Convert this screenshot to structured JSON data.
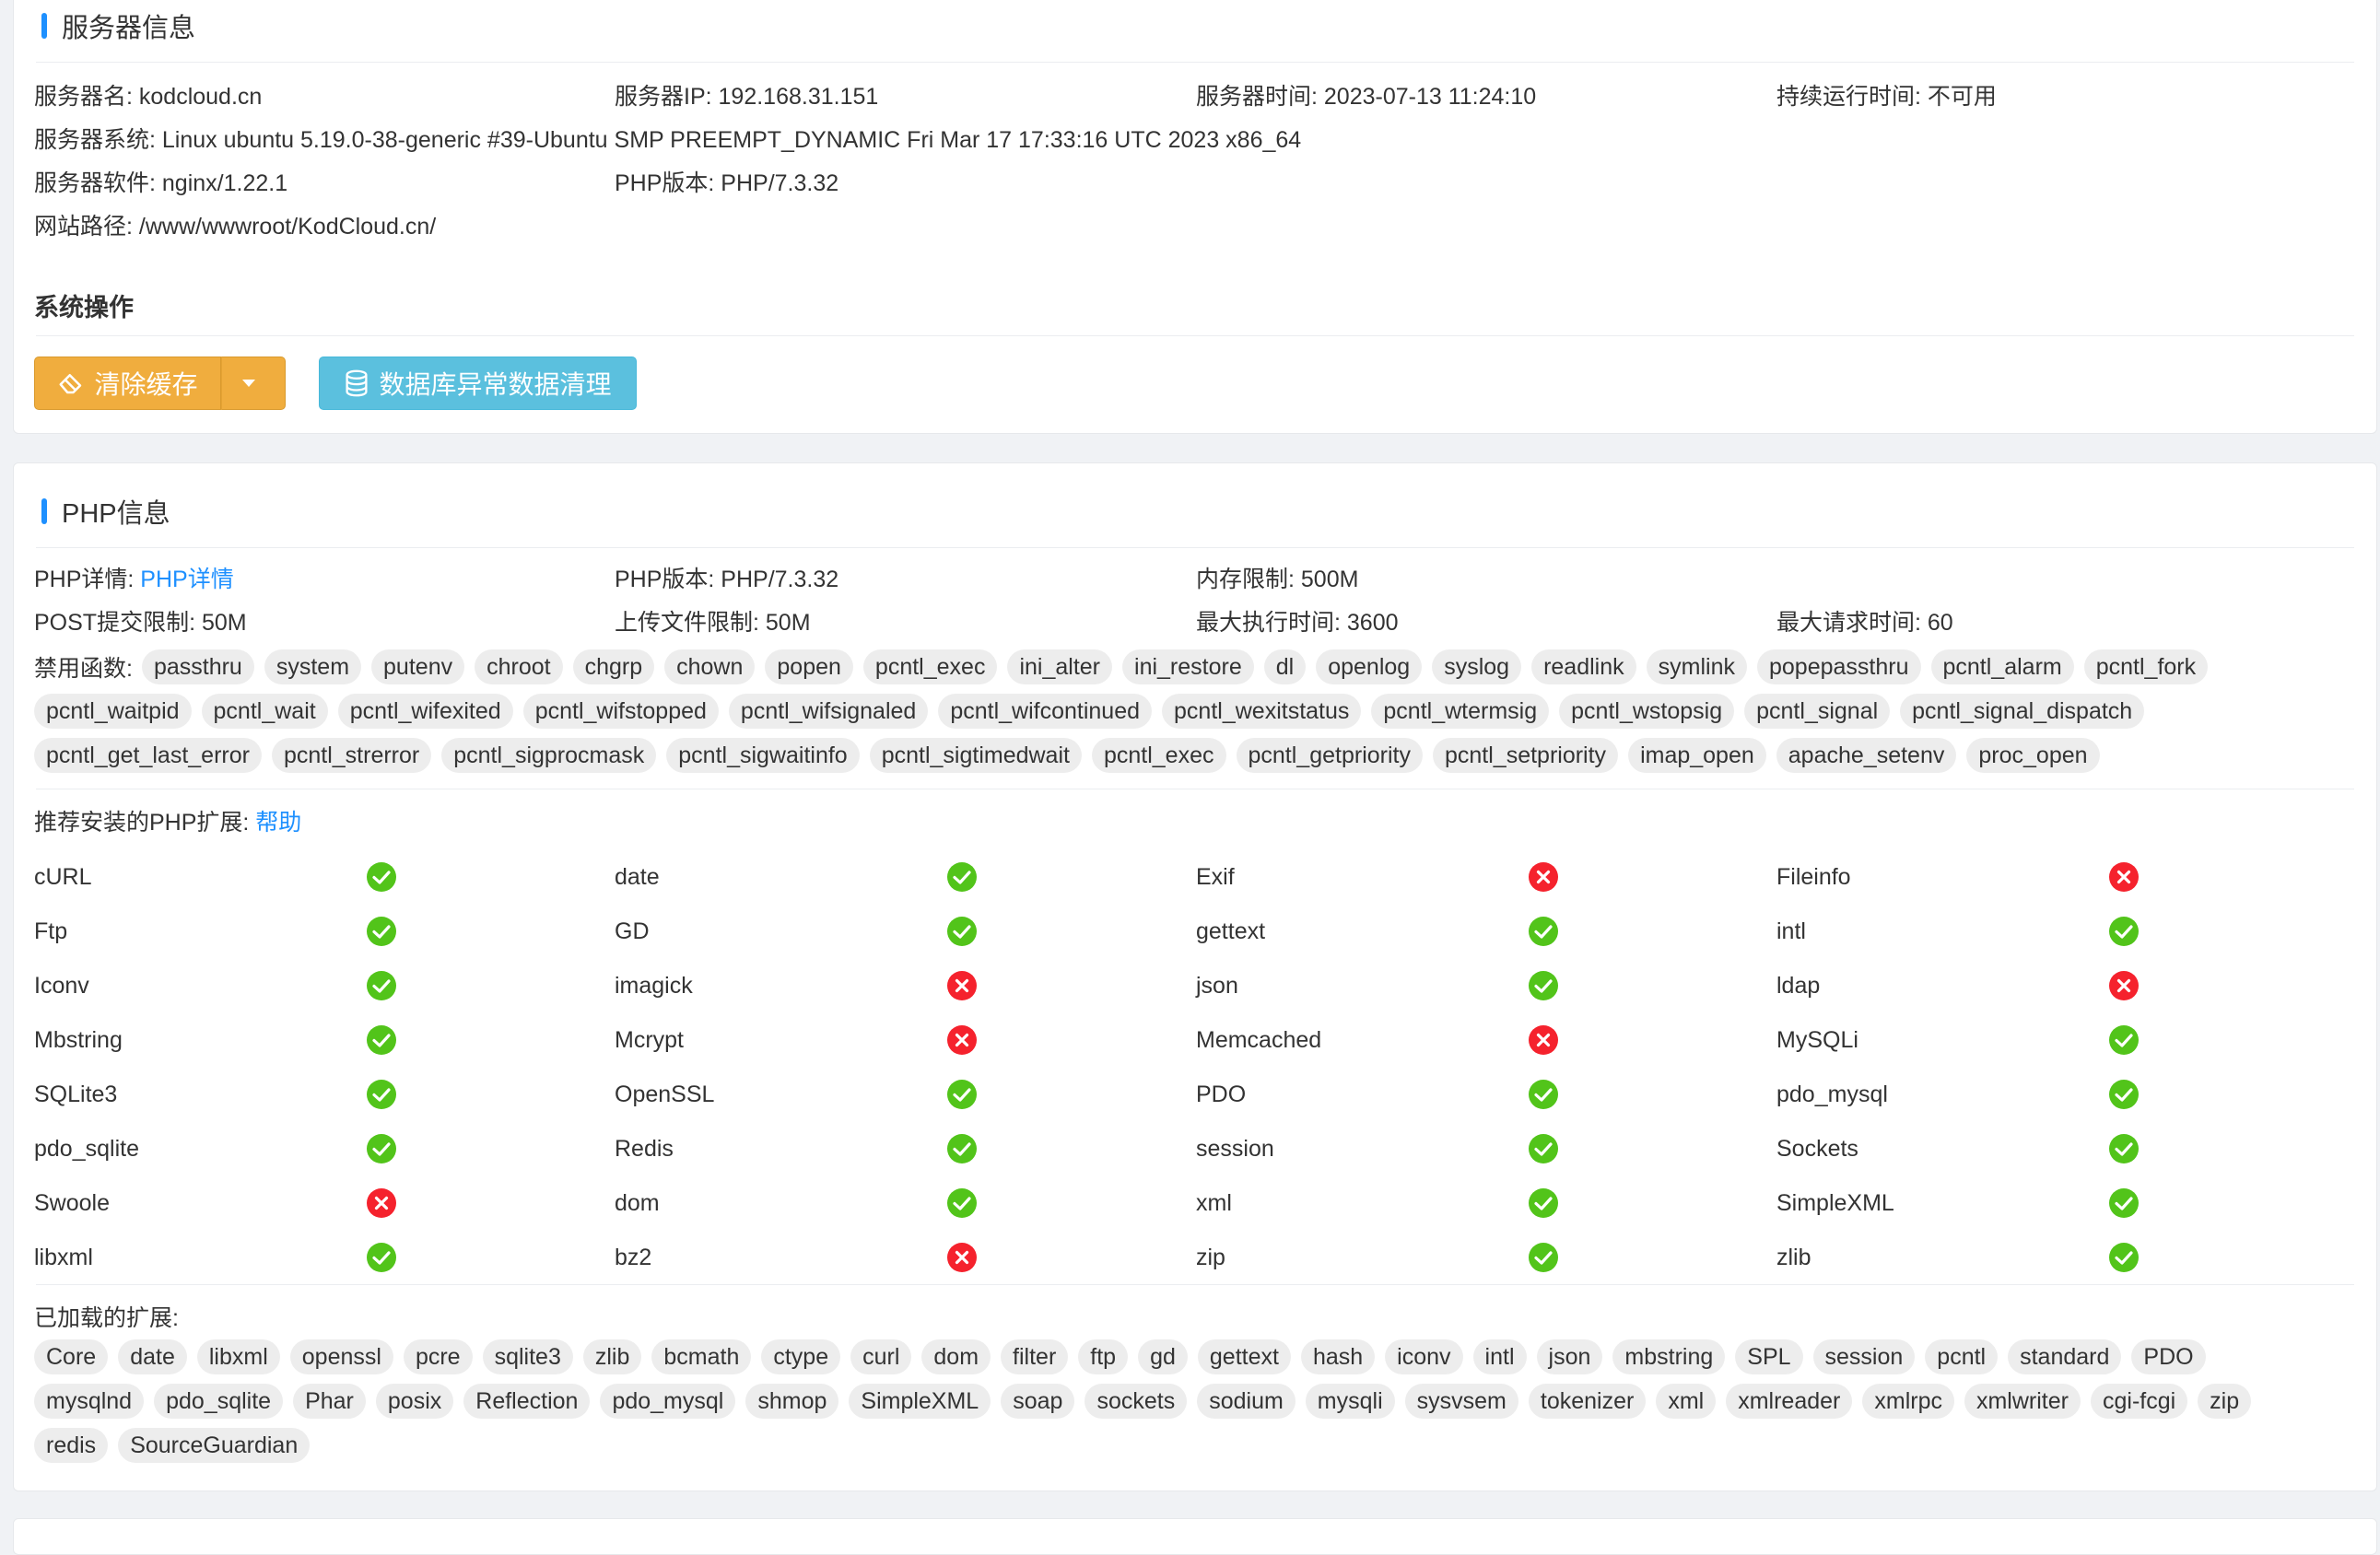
{
  "server": {
    "title": "服务器信息",
    "row1": [
      "服务器名: kodcloud.cn",
      "服务器IP: 192.168.31.151",
      "服务器时间: 2023-07-13 11:24:10",
      "持续运行时间: 不可用"
    ],
    "os": "服务器系统: Linux ubuntu 5.19.0-38-generic #39-Ubuntu SMP PREEMPT_DYNAMIC Fri Mar 17 17:33:16 UTC 2023 x86_64",
    "software": "服务器软件: nginx/1.22.1",
    "php_version": "PHP版本: PHP/7.3.32",
    "web_path": "网站路径: /www/wwwroot/KodCloud.cn/"
  },
  "ops": {
    "title": "系统操作",
    "clear_cache_label": "清除缓存",
    "db_clean_label": "数据库异常数据清理"
  },
  "php": {
    "title": "PHP信息",
    "detail_prefix": "PHP详情: ",
    "detail_link": "PHP详情",
    "version": "PHP版本: PHP/7.3.32",
    "memory_limit": "内存限制: 500M",
    "post_limit": "POST提交限制: 50M",
    "upload_limit": "上传文件限制: 50M",
    "max_exec": "最大执行时间: 3600",
    "max_request": "最大请求时间: 60",
    "disabled_label": "禁用函数:",
    "disabled_functions": [
      [
        "passthru",
        "system",
        "putenv",
        "chroot",
        "chgrp",
        "chown",
        "popen",
        "pcntl_exec",
        "ini_alter",
        "ini_restore",
        "dl",
        "openlog",
        "syslog",
        "readlink",
        "symlink",
        "popepassthru",
        "pcntl_alarm",
        "pcntl_fork"
      ],
      [
        "pcntl_waitpid",
        "pcntl_wait",
        "pcntl_wifexited",
        "pcntl_wifstopped",
        "pcntl_wifsignaled",
        "pcntl_wifcontinued",
        "pcntl_wexitstatus",
        "pcntl_wtermsig",
        "pcntl_wstopsig",
        "pcntl_signal",
        "pcntl_signal_dispatch"
      ],
      [
        "pcntl_get_last_error",
        "pcntl_strerror",
        "pcntl_sigprocmask",
        "pcntl_sigwaitinfo",
        "pcntl_sigtimedwait",
        "pcntl_exec",
        "pcntl_getpriority",
        "pcntl_setpriority",
        "imap_open",
        "apache_setenv",
        "proc_open"
      ]
    ],
    "recommended_label": "推荐安装的PHP扩展: ",
    "help_link": "帮助",
    "extensions": [
      [
        [
          "cURL",
          true
        ],
        [
          "date",
          true
        ],
        [
          "Exif",
          false
        ],
        [
          "Fileinfo",
          false
        ]
      ],
      [
        [
          "Ftp",
          true
        ],
        [
          "GD",
          true
        ],
        [
          "gettext",
          true
        ],
        [
          "intl",
          true
        ]
      ],
      [
        [
          "Iconv",
          true
        ],
        [
          "imagick",
          false
        ],
        [
          "json",
          true
        ],
        [
          "ldap",
          false
        ]
      ],
      [
        [
          "Mbstring",
          true
        ],
        [
          "Mcrypt",
          false
        ],
        [
          "Memcached",
          false
        ],
        [
          "MySQLi",
          true
        ]
      ],
      [
        [
          "SQLite3",
          true
        ],
        [
          "OpenSSL",
          true
        ],
        [
          "PDO",
          true
        ],
        [
          "pdo_mysql",
          true
        ]
      ],
      [
        [
          "pdo_sqlite",
          true
        ],
        [
          "Redis",
          true
        ],
        [
          "session",
          true
        ],
        [
          "Sockets",
          true
        ]
      ],
      [
        [
          "Swoole",
          false
        ],
        [
          "dom",
          true
        ],
        [
          "xml",
          true
        ],
        [
          "SimpleXML",
          true
        ]
      ],
      [
        [
          "libxml",
          true
        ],
        [
          "bz2",
          false
        ],
        [
          "zip",
          true
        ],
        [
          "zlib",
          true
        ]
      ]
    ],
    "loaded_label": "已加载的扩展:",
    "loaded_extensions": [
      [
        "Core",
        "date",
        "libxml",
        "openssl",
        "pcre",
        "sqlite3",
        "zlib",
        "bcmath",
        "ctype",
        "curl",
        "dom",
        "filter",
        "ftp",
        "gd",
        "gettext",
        "hash",
        "iconv",
        "intl",
        "json",
        "mbstring",
        "SPL",
        "session",
        "pcntl",
        "standard",
        "PDO"
      ],
      [
        "mysqlnd",
        "pdo_sqlite",
        "Phar",
        "posix",
        "Reflection",
        "pdo_mysql",
        "shmop",
        "SimpleXML",
        "soap",
        "sockets",
        "sodium",
        "mysqli",
        "sysvsem",
        "tokenizer",
        "xml",
        "xmlreader",
        "xmlrpc",
        "xmlwriter",
        "cgi-fcgi",
        "zip"
      ],
      [
        "redis",
        "SourceGuardian"
      ]
    ]
  },
  "colors": {
    "accent": "#1e90ff",
    "ok": "#52c41a",
    "fail": "#f5222d",
    "orange": "#f0ad3e",
    "info": "#5bc0de"
  },
  "icons": {
    "ok": "check-circle-icon",
    "fail": "close-circle-icon",
    "clear": "eraser-icon",
    "db": "database-icon"
  }
}
